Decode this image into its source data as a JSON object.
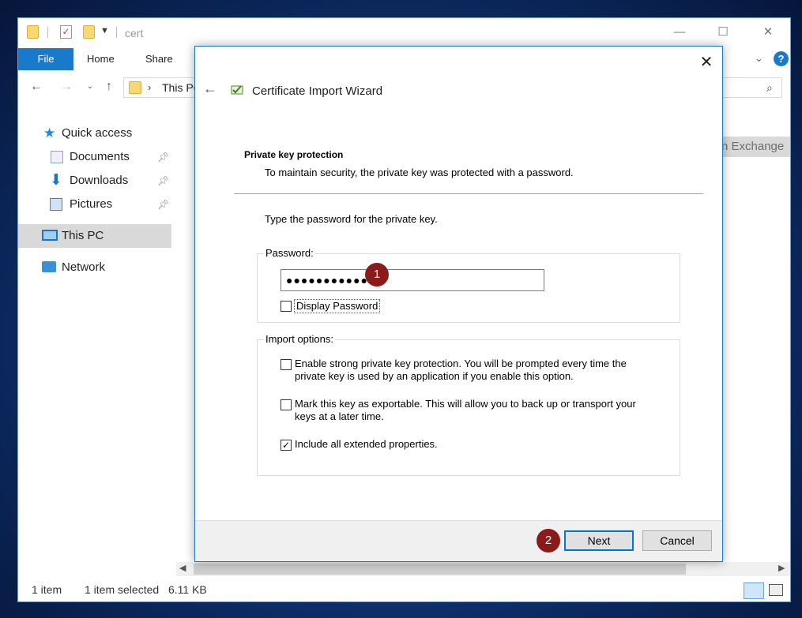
{
  "explorer": {
    "path": "cert",
    "window_controls": {
      "minimize": "—",
      "maximize": "☐",
      "close": "✕"
    },
    "ribbon": {
      "file": "File",
      "home": "Home",
      "share": "Share",
      "help": "?"
    },
    "address": {
      "separator": "›",
      "this_pc": "This PC"
    },
    "nav": {
      "quick_access": "Quick access",
      "documents": "Documents",
      "downloads": "Downloads",
      "pictures": "Pictures",
      "this_pc": "This PC",
      "network": "Network"
    },
    "content_partial": "n Exchange",
    "status": {
      "count": "1 item",
      "selected": "1 item selected",
      "size": "6.11 KB"
    }
  },
  "dialog": {
    "title": "Certificate Import Wizard",
    "close": "✕",
    "section_title": "Private key protection",
    "section_desc": "To maintain security, the private key was protected with a password.",
    "prompt": "Type the password for the private key.",
    "password_label": "Password:",
    "password_value": "●●●●●●●●●●●",
    "display_password": {
      "label": "Display Password",
      "checked": false
    },
    "import_options_label": "Import options:",
    "options": [
      {
        "line1": "Enable strong private key protection. You will be prompted every time the",
        "line2": "private key is used by an application if you enable this option.",
        "checked": false
      },
      {
        "line1": "Mark this key as exportable. This will allow you to back up or transport your",
        "line2": "keys at a later time.",
        "checked": false
      },
      {
        "line1": "Include all extended properties.",
        "line2": "",
        "checked": true
      }
    ],
    "next": "Next",
    "cancel": "Cancel"
  },
  "annotations": {
    "step1": "1",
    "step2": "2",
    "color": "#8b1a1a"
  }
}
